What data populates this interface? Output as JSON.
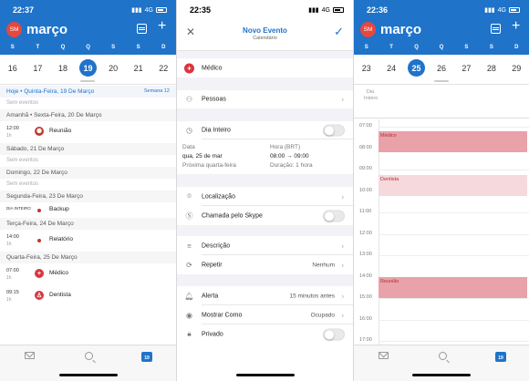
{
  "colors": {
    "accent": "#1f73c9",
    "avatar": "#e4483f",
    "event": "#e9a2a9",
    "event_light": "#f6d9dc"
  },
  "panel1": {
    "status": {
      "time": "22:37",
      "net": "4G"
    },
    "avatar": "SM",
    "month": "março",
    "weekdays": [
      "S",
      "T",
      "Q",
      "Q",
      "S",
      "S",
      "D"
    ],
    "dates": [
      "16",
      "17",
      "18",
      "19",
      "20",
      "21",
      "22"
    ],
    "selected_index": 3,
    "agenda": [
      {
        "type": "header",
        "text": "Hoje • Quinta-Feira, 19 De Março",
        "week": "Semana 12",
        "today": true
      },
      {
        "type": "empty",
        "text": "Sem eventos"
      },
      {
        "type": "header",
        "text": "Amanhã • Sexta-Feira, 20 De Março"
      },
      {
        "type": "event",
        "time": "12:00",
        "dur": "1h",
        "title": "Reunião",
        "icon": "group-icon"
      },
      {
        "type": "header",
        "text": "Sábado, 21 De Março"
      },
      {
        "type": "empty",
        "text": "Sem eventos"
      },
      {
        "type": "header",
        "text": "Domingo, 22 De Março"
      },
      {
        "type": "empty",
        "text": "Sem eventos"
      },
      {
        "type": "header",
        "text": "Segunda-Feira, 23 De Março"
      },
      {
        "type": "event_dot",
        "time": "DIA INTEIRO",
        "title": "Backup"
      },
      {
        "type": "header",
        "text": "Terça-Feira, 24 De Março"
      },
      {
        "type": "event_dot2",
        "time": "14:00",
        "dur": "1h",
        "title": "Relatório"
      },
      {
        "type": "header",
        "text": "Quarta-Feira, 25 De Março"
      },
      {
        "type": "event",
        "time": "07:00",
        "dur": "1h",
        "title": "Médico",
        "icon": "medical-cross-icon"
      },
      {
        "type": "event",
        "time": "09:15",
        "dur": "1h",
        "title": "Dentista",
        "icon": "tooth-icon"
      }
    ],
    "tabbar": {
      "cal_day": "19"
    }
  },
  "panel2": {
    "status": {
      "time": "22:35",
      "net": "4G"
    },
    "title": "Novo Evento",
    "subtitle": "Calendário",
    "event_title": "Médico",
    "people": "Pessoas",
    "all_day": "Dia Inteiro",
    "date_label": "Data",
    "date_value": "qua, 25 de mar",
    "date_next": "Próxima quarta-feira",
    "time_label": "Hora (BRT)",
    "time_value": "08:00 → 09:00",
    "duration": "Duração: 1 hora",
    "location": "Localização",
    "skype": "Chamada pelo Skype",
    "description": "Descrição",
    "repeat": "Repetir",
    "repeat_value": "Nenhum",
    "alert": "Alerta",
    "alert_value": "15 minutos antes",
    "show_as": "Mostrar Como",
    "show_as_value": "Ocupado",
    "private": "Privado"
  },
  "panel3": {
    "status": {
      "time": "22:36",
      "net": "4G"
    },
    "avatar": "SM",
    "month": "março",
    "weekdays": [
      "S",
      "T",
      "Q",
      "Q",
      "S",
      "S",
      "D"
    ],
    "dates": [
      "23",
      "24",
      "25",
      "26",
      "27",
      "28",
      "29"
    ],
    "selected_index": 2,
    "allday_label": "Dia Inteiro",
    "hours": [
      "07:00",
      "08:00",
      "09:00",
      "10:00",
      "11:00",
      "12:00",
      "13:00",
      "14:00",
      "15:00",
      "16:00",
      "17:00"
    ],
    "events": [
      {
        "title": "Médico",
        "start": 7.2,
        "end": 8.2
      },
      {
        "title": "Dentista",
        "start": 9.25,
        "end": 10.25
      },
      {
        "title": "Reunião",
        "start": 14.0,
        "end": 15.0
      }
    ],
    "tabbar": {
      "cal_day": "19"
    }
  }
}
